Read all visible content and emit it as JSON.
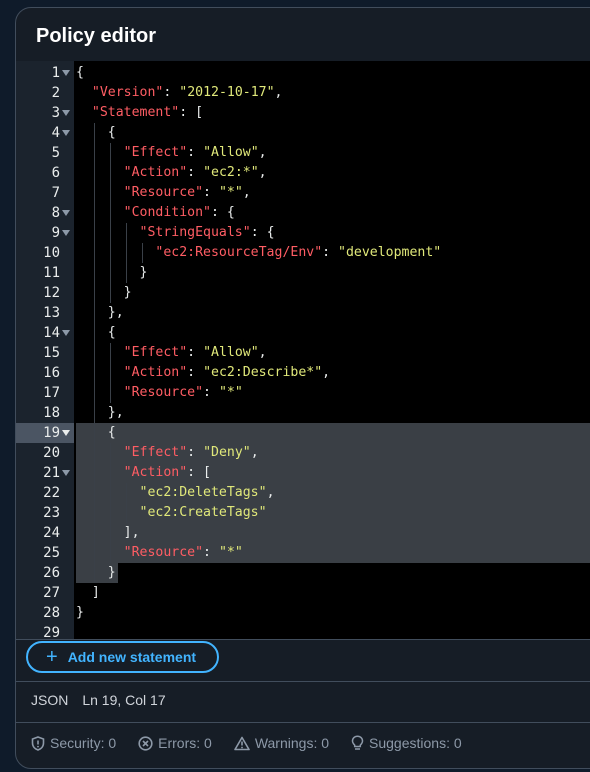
{
  "panel": {
    "title": "Policy editor"
  },
  "editor": {
    "active_line": 19,
    "lines": [
      [
        [
          "p",
          "{"
        ]
      ],
      [
        [
          "p",
          "  "
        ],
        [
          "k",
          "\"Version\""
        ],
        [
          "p",
          ": "
        ],
        [
          "s",
          "\"2012-10-17\""
        ],
        [
          "p",
          ","
        ]
      ],
      [
        [
          "p",
          "  "
        ],
        [
          "k",
          "\"Statement\""
        ],
        [
          "p",
          ": ["
        ]
      ],
      [
        [
          "p",
          "    {"
        ]
      ],
      [
        [
          "p",
          "      "
        ],
        [
          "k",
          "\"Effect\""
        ],
        [
          "p",
          ": "
        ],
        [
          "s",
          "\"Allow\""
        ],
        [
          "p",
          ","
        ]
      ],
      [
        [
          "p",
          "      "
        ],
        [
          "k",
          "\"Action\""
        ],
        [
          "p",
          ": "
        ],
        [
          "s",
          "\"ec2:*\""
        ],
        [
          "p",
          ","
        ]
      ],
      [
        [
          "p",
          "      "
        ],
        [
          "k",
          "\"Resource\""
        ],
        [
          "p",
          ": "
        ],
        [
          "s",
          "\"*\""
        ],
        [
          "p",
          ","
        ]
      ],
      [
        [
          "p",
          "      "
        ],
        [
          "k",
          "\"Condition\""
        ],
        [
          "p",
          ": {"
        ]
      ],
      [
        [
          "p",
          "        "
        ],
        [
          "k",
          "\"StringEquals\""
        ],
        [
          "p",
          ": {"
        ]
      ],
      [
        [
          "p",
          "          "
        ],
        [
          "k",
          "\"ec2:ResourceTag/Env\""
        ],
        [
          "p",
          ": "
        ],
        [
          "s",
          "\"development\""
        ]
      ],
      [
        [
          "p",
          "        }"
        ]
      ],
      [
        [
          "p",
          "      }"
        ]
      ],
      [
        [
          "p",
          "    },"
        ]
      ],
      [
        [
          "p",
          "    {"
        ]
      ],
      [
        [
          "p",
          "      "
        ],
        [
          "k",
          "\"Effect\""
        ],
        [
          "p",
          ": "
        ],
        [
          "s",
          "\"Allow\""
        ],
        [
          "p",
          ","
        ]
      ],
      [
        [
          "p",
          "      "
        ],
        [
          "k",
          "\"Action\""
        ],
        [
          "p",
          ": "
        ],
        [
          "s",
          "\"ec2:Describe*\""
        ],
        [
          "p",
          ","
        ]
      ],
      [
        [
          "p",
          "      "
        ],
        [
          "k",
          "\"Resource\""
        ],
        [
          "p",
          ": "
        ],
        [
          "s",
          "\"*\""
        ]
      ],
      [
        [
          "p",
          "    },"
        ]
      ],
      [
        [
          "p",
          "    {"
        ]
      ],
      [
        [
          "p",
          "      "
        ],
        [
          "k",
          "\"Effect\""
        ],
        [
          "p",
          ": "
        ],
        [
          "s",
          "\"Deny\""
        ],
        [
          "p",
          ","
        ]
      ],
      [
        [
          "p",
          "      "
        ],
        [
          "k",
          "\"Action\""
        ],
        [
          "p",
          ": ["
        ]
      ],
      [
        [
          "p",
          "        "
        ],
        [
          "s",
          "\"ec2:DeleteTags\""
        ],
        [
          "p",
          ","
        ]
      ],
      [
        [
          "p",
          "        "
        ],
        [
          "s",
          "\"ec2:CreateTags\""
        ]
      ],
      [
        [
          "p",
          "      ],"
        ]
      ],
      [
        [
          "p",
          "      "
        ],
        [
          "k",
          "\"Resource\""
        ],
        [
          "p",
          ": "
        ],
        [
          "s",
          "\"*\""
        ]
      ],
      [
        [
          "p",
          "    }"
        ]
      ],
      [
        [
          "p",
          "  ]"
        ]
      ],
      [
        [
          "p",
          "}"
        ]
      ],
      [
        [
          "p",
          ""
        ]
      ]
    ],
    "foldable_lines": [
      1,
      3,
      4,
      8,
      9,
      14,
      19,
      21
    ]
  },
  "actions": {
    "add_statement_label": "Add new statement"
  },
  "status": {
    "language": "JSON",
    "cursor": "Ln 19, Col 17"
  },
  "counts": {
    "security": "Security: 0",
    "errors": "Errors: 0",
    "warnings": "Warnings: 0",
    "suggestions": "Suggestions: 0"
  },
  "colors": {
    "key": "#ff5d64",
    "string": "#e0e87a",
    "accent": "#42b4ff",
    "background": "#161d26"
  }
}
